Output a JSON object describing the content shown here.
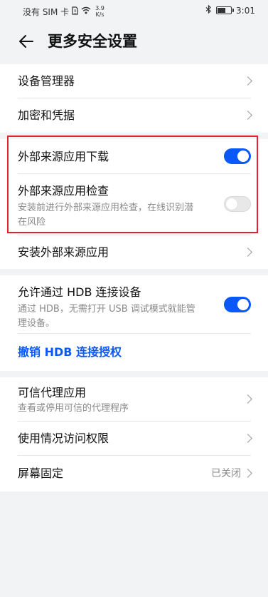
{
  "status_bar": {
    "carrier": "没有 SIM 卡",
    "speed_value": "3.9",
    "speed_unit": "K/s",
    "time": "3:01",
    "icons": [
      "sim-card-icon",
      "wifi-icon",
      "bluetooth-icon",
      "battery-icon"
    ],
    "battery_level": 0.65
  },
  "header": {
    "title": "更多安全设置",
    "back_icon": "arrow-left-icon"
  },
  "groups": {
    "device": {
      "admin": "设备管理器",
      "encryption": "加密和凭据"
    },
    "external": {
      "download": {
        "label": "外部来源应用下载",
        "enabled": true
      },
      "check": {
        "label": "外部来源应用检查",
        "desc": "安装前进行外部来源应用检查，在线识别潜在风险",
        "enabled": false
      },
      "install": "安装外部来源应用"
    },
    "hdb": {
      "allow": {
        "label": "允许通过 HDB 连接设备",
        "desc": "通过 HDB，无需打开 USB 调试模式就能管理设备。",
        "enabled": true
      },
      "revoke": "撤销 HDB 连接授权"
    },
    "misc": {
      "trust_agent": {
        "label": "可信代理应用",
        "desc": "查看或停用可信的代理程序"
      },
      "usage_access": "使用情况访问权限",
      "pinning": {
        "label": "屏幕固定",
        "value": "已关闭"
      }
    }
  },
  "colors": {
    "accent": "#0a59f7",
    "highlight": "#e8202a",
    "background": "#f1f3f5"
  }
}
